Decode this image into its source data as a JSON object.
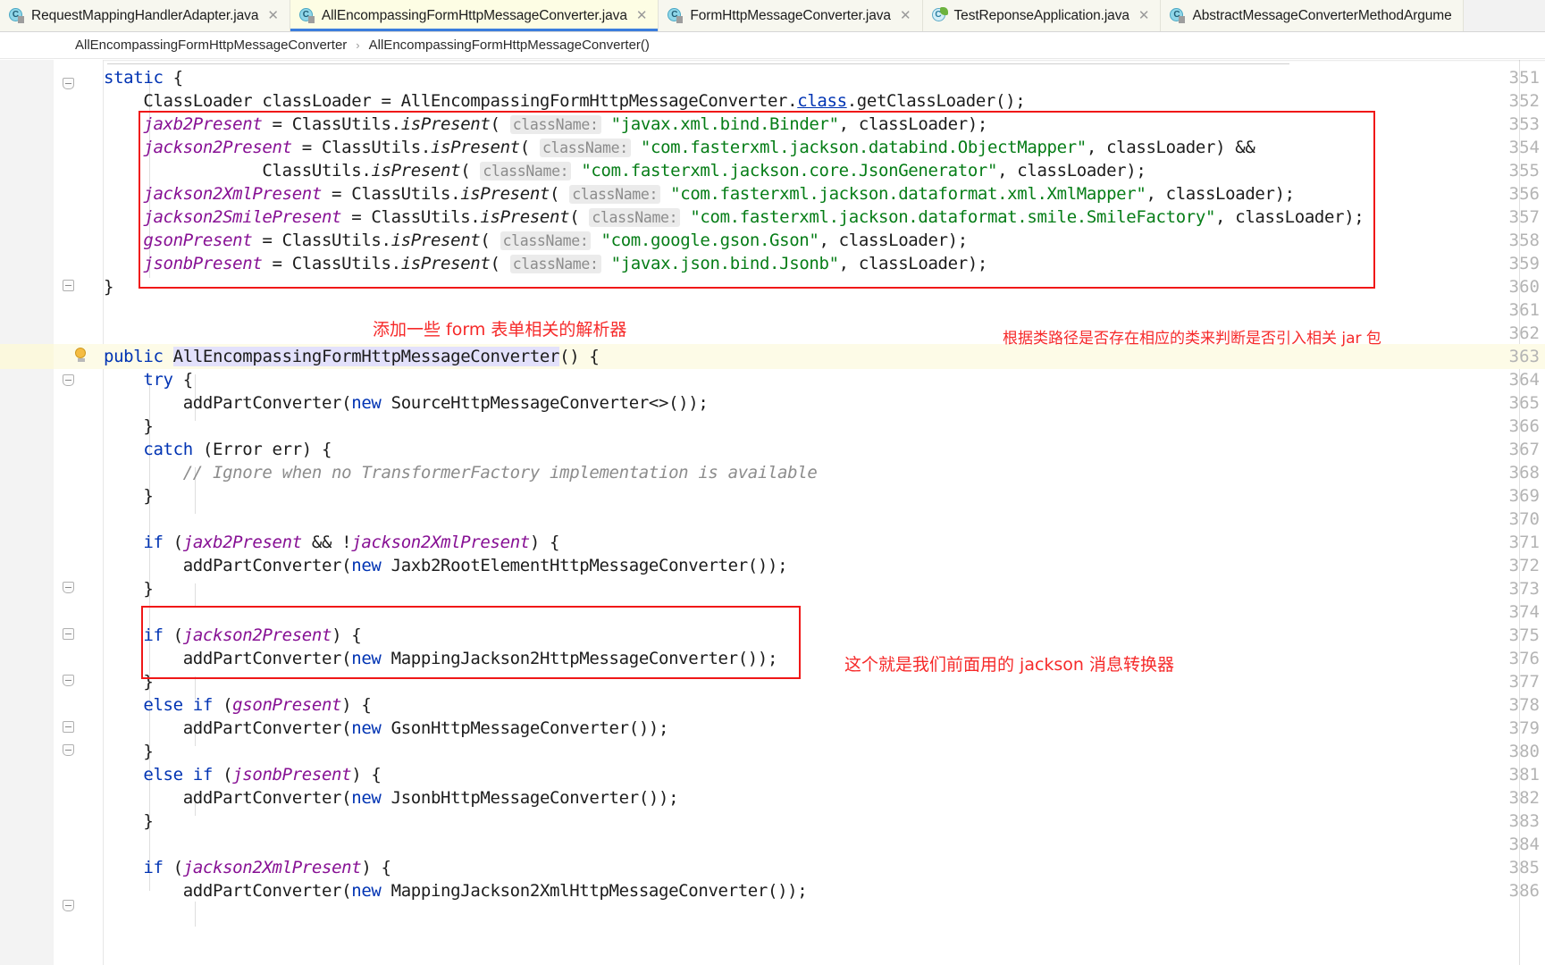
{
  "window": {
    "app": "IntelliJ IDEA",
    "theme_accent": "#3b7ddd",
    "annotation_color": "#f62a2a"
  },
  "tabs": [
    {
      "label": "RequestMappingHandlerAdapter.java",
      "icon": "java-class-icon",
      "active": false,
      "close": "✕"
    },
    {
      "label": "AllEncompassingFormHttpMessageConverter.java",
      "icon": "java-class-icon",
      "active": true,
      "close": "✕"
    },
    {
      "label": "FormHttpMessageConverter.java",
      "icon": "java-class-icon",
      "active": false,
      "close": "✕"
    },
    {
      "label": "TestReponseApplication.java",
      "icon": "spring-boot-class-icon",
      "active": false,
      "close": "✕"
    },
    {
      "label": "AbstractMessageConverterMethodArgume",
      "icon": "java-class-icon",
      "active": false,
      "close": ""
    }
  ],
  "breadcrumb": {
    "items": [
      "AllEncompassingFormHttpMessageConverter",
      "AllEncompassingFormHttpMessageConverter()"
    ],
    "separator": "›"
  },
  "gutter": {
    "line_numbers": [
      "351",
      "352",
      "353",
      "354",
      "355",
      "356",
      "357",
      "358",
      "359",
      "360",
      "361",
      "362",
      "363",
      "364",
      "365",
      "366",
      "367",
      "368",
      "369",
      "370",
      "371",
      "372",
      "373",
      "374",
      "375",
      "376",
      "377",
      "378",
      "379",
      "380",
      "381",
      "382",
      "383",
      "384",
      "385",
      "386"
    ]
  },
  "code": {
    "lines": [
      {
        "n": "351",
        "text": "    static {"
      },
      {
        "n": "352",
        "text": "        ClassLoader classLoader = AllEncompassingFormHttpMessageConverter.class.getClassLoader();"
      },
      {
        "n": "353",
        "text": "        jaxb2Present = ClassUtils.isPresent( className: \"javax.xml.bind.Binder\", classLoader);"
      },
      {
        "n": "354",
        "text": "        jackson2Present = ClassUtils.isPresent( className: \"com.fasterxml.jackson.databind.ObjectMapper\", classLoader) &&"
      },
      {
        "n": "355",
        "text": "                        ClassUtils.isPresent( className: \"com.fasterxml.jackson.core.JsonGenerator\", classLoader);"
      },
      {
        "n": "356",
        "text": "        jackson2XmlPresent = ClassUtils.isPresent( className: \"com.fasterxml.jackson.dataformat.xml.XmlMapper\", classLoader);"
      },
      {
        "n": "357",
        "text": "        jackson2SmilePresent = ClassUtils.isPresent( className: \"com.fasterxml.jackson.dataformat.smile.SmileFactory\", classLoader);"
      },
      {
        "n": "358",
        "text": "        gsonPresent = ClassUtils.isPresent( className: \"com.google.gson.Gson\", classLoader);"
      },
      {
        "n": "359",
        "text": "        jsonbPresent = ClassUtils.isPresent( className: \"javax.json.bind.Jsonb\", classLoader);"
      },
      {
        "n": "360",
        "text": "    }"
      },
      {
        "n": "361",
        "text": ""
      },
      {
        "n": "362",
        "text": ""
      },
      {
        "n": "363",
        "text": "    public AllEncompassingFormHttpMessageConverter() {"
      },
      {
        "n": "364",
        "text": "        try {"
      },
      {
        "n": "365",
        "text": "            addPartConverter(new SourceHttpMessageConverter<>());"
      },
      {
        "n": "366",
        "text": "        }"
      },
      {
        "n": "367",
        "text": "        catch (Error err) {"
      },
      {
        "n": "368",
        "text": "            // Ignore when no TransformerFactory implementation is available"
      },
      {
        "n": "369",
        "text": "        }"
      },
      {
        "n": "370",
        "text": ""
      },
      {
        "n": "371",
        "text": "        if (jaxb2Present && !jackson2XmlPresent) {"
      },
      {
        "n": "372",
        "text": "            addPartConverter(new Jaxb2RootElementHttpMessageConverter());"
      },
      {
        "n": "373",
        "text": "        }"
      },
      {
        "n": "374",
        "text": ""
      },
      {
        "n": "375",
        "text": "        if (jackson2Present) {"
      },
      {
        "n": "376",
        "text": "            addPartConverter(new MappingJackson2HttpMessageConverter());"
      },
      {
        "n": "377",
        "text": "        }"
      },
      {
        "n": "378",
        "text": "        else if (gsonPresent) {"
      },
      {
        "n": "379",
        "text": "            addPartConverter(new GsonHttpMessageConverter());"
      },
      {
        "n": "380",
        "text": "        }"
      },
      {
        "n": "381",
        "text": "        else if (jsonbPresent) {"
      },
      {
        "n": "382",
        "text": "            addPartConverter(new JsonbHttpMessageConverter());"
      },
      {
        "n": "383",
        "text": "        }"
      },
      {
        "n": "384",
        "text": ""
      },
      {
        "n": "385",
        "text": "        if (jackson2XmlPresent) {"
      },
      {
        "n": "386",
        "text": "            addPartConverter(new MappingJackson2XmlHttpMessageConverter());"
      }
    ]
  },
  "annotations": [
    {
      "id": "classpath-note",
      "text": "根据类路径是否存在相应的类来判断是否引入相关 jar 包"
    },
    {
      "id": "form-parser-note",
      "text": "添加一些 form 表单相关的解析器"
    },
    {
      "id": "jackson-note",
      "text": "这个就是我们前面用的 jackson 消息转换器"
    }
  ]
}
